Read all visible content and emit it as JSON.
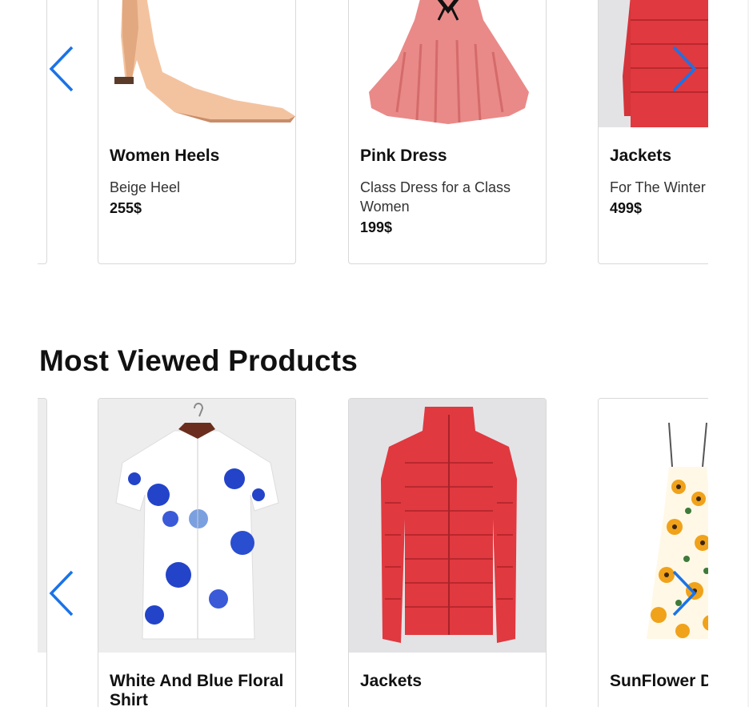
{
  "top_carousel": {
    "products": [
      {
        "name": "Women Heels",
        "description": "Beige Heel",
        "price": "255$"
      },
      {
        "name": "Pink Dress",
        "description": "Class Dress for a Class Women",
        "price": "199$"
      },
      {
        "name": "Jackets",
        "description": "For The Winter",
        "price": "499$"
      }
    ]
  },
  "most_viewed": {
    "title": "Most Viewed Products",
    "products": [
      {
        "name": "White And Blue Floral Shirt"
      },
      {
        "name": "Jackets"
      },
      {
        "name": "SunFlower Dress"
      }
    ]
  },
  "colors": {
    "arrow": "#1a73e8",
    "jacket_red": "#e0393f",
    "dress_pink": "#e98a88"
  },
  "icons": {
    "prev": "chevron-left-icon",
    "next": "chevron-right-icon"
  }
}
